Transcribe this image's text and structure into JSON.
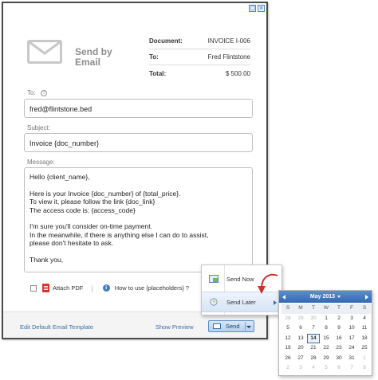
{
  "window": {
    "controls": [
      "restore-icon",
      "close-icon"
    ]
  },
  "header": {
    "title": "Send by Email",
    "doc_fields": [
      {
        "key": "Document:",
        "value": "INVOICE I-006"
      },
      {
        "key": "To:",
        "value": "Fred Flintstone"
      },
      {
        "key": "Total:",
        "value": "$ 500.00"
      }
    ]
  },
  "form": {
    "to_label": "To:",
    "to_help": "?",
    "to_value": "fred@flintstone.bed",
    "subject_label": "Subject:",
    "subject_value": "Invoice {doc_number}",
    "message_label": "Message:",
    "message_lines": {
      "greeting": "Hello {client_name},",
      "body": "Here is your Invoice {doc_number} of {total_price}.\nTo view it, please follow the link {doc_link}\nThe access code is: {access_code}",
      "closing": "I'm sure you'll consider on-time payment.\nIn the meanwhile, if there is anything else I can do to assist,\nplease don't hesitate to ask.",
      "signoff": "Thank you,"
    }
  },
  "options": {
    "attach_pdf_label": "Attach PDF",
    "attach_pdf_checked": false,
    "placeholders_help_label": "How to use {placeholders} ?",
    "info_glyph": "i"
  },
  "footer": {
    "edit_template_label": "Edit Default Email Template",
    "show_preview_label": "Show Preview",
    "send_label": "Send"
  },
  "send_menu": {
    "items": [
      {
        "label": "Send Now",
        "icon": "send-now-icon"
      },
      {
        "label": "Send Later",
        "icon": "clock-icon",
        "highlighted": true
      }
    ]
  },
  "calendar": {
    "month_label": "May 2013",
    "weekdays": [
      "S",
      "M",
      "T",
      "W",
      "T",
      "F",
      "S"
    ],
    "weeks": [
      [
        "28",
        "29",
        "30",
        "1",
        "2",
        "3",
        "4"
      ],
      [
        "5",
        "6",
        "7",
        "8",
        "9",
        "10",
        "11"
      ],
      [
        "12",
        "13",
        "14",
        "15",
        "16",
        "17",
        "18"
      ],
      [
        "19",
        "20",
        "21",
        "22",
        "23",
        "24",
        "25"
      ],
      [
        "26",
        "27",
        "28",
        "29",
        "30",
        "31",
        "1"
      ],
      [
        "2",
        "3",
        "4",
        "5",
        "6",
        "7",
        "8"
      ]
    ],
    "today": "14",
    "accent": "#3367b3"
  }
}
